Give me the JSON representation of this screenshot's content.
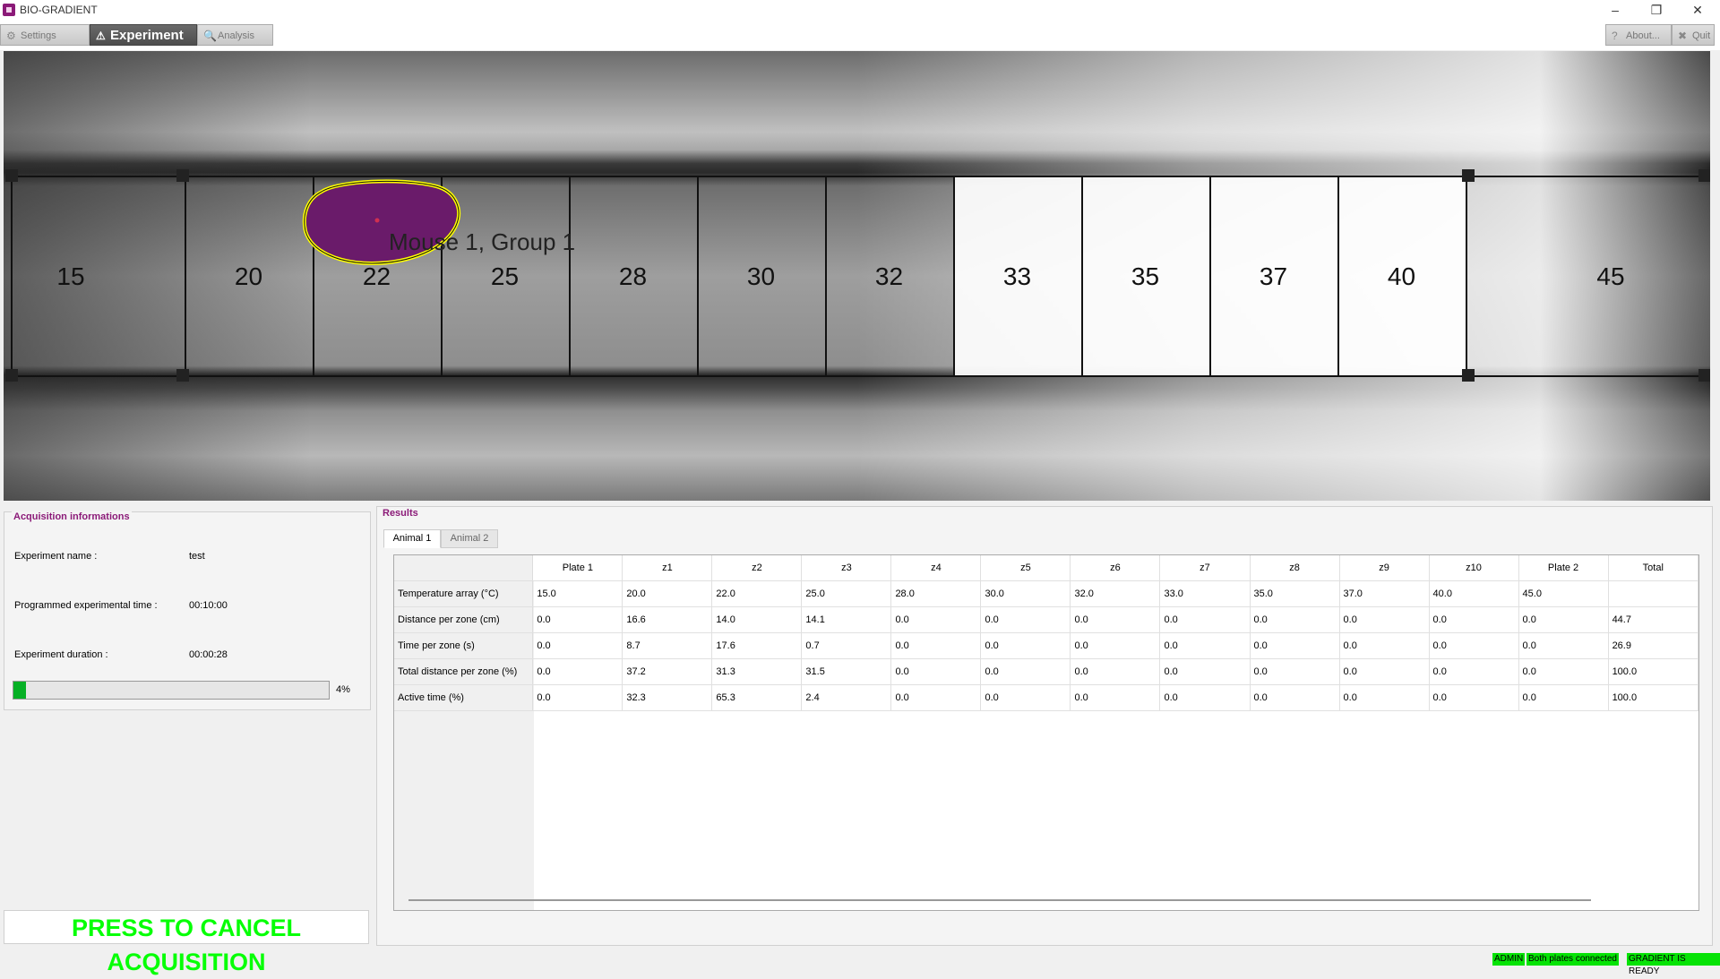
{
  "window": {
    "title": "BIO-GRADIENT",
    "minimize": "–",
    "restore": "❐",
    "close": "✕"
  },
  "toolbar": {
    "tabs": [
      {
        "label": "Settings",
        "icon": "⚙"
      },
      {
        "label": "Experiment",
        "icon": "⚠"
      },
      {
        "label": "Analysis",
        "icon": "🔍"
      }
    ],
    "about_label": "About...",
    "about_icon": "?",
    "quit_label": "Quit",
    "quit_icon": "✖"
  },
  "camera": {
    "zone_labels": [
      "15",
      "20",
      "22",
      "25",
      "28",
      "30",
      "32",
      "33",
      "35",
      "37",
      "40",
      "45"
    ],
    "mouse_label": "Mouse 1, Group 1"
  },
  "acquisition": {
    "title": "Acquisition informations",
    "experiment_name_label": "Experiment name :",
    "experiment_name": "test",
    "programmed_time_label": "Programmed experimental time :",
    "programmed_time": "00:10:00",
    "duration_label": "Experiment duration :",
    "duration": "00:00:28",
    "progress_percent": 4,
    "progress_text": "4%"
  },
  "cancel_button": "PRESS TO CANCEL ACQUISITION",
  "results": {
    "title": "Results",
    "tabs": [
      "Animal 1",
      "Animal 2"
    ],
    "columns": [
      "Plate 1",
      "z1",
      "z2",
      "z3",
      "z4",
      "z5",
      "z6",
      "z7",
      "z8",
      "z9",
      "z10",
      "Plate 2",
      "Total"
    ],
    "rows": [
      {
        "label": "Temperature array (°C)",
        "values": [
          "15.0",
          "20.0",
          "22.0",
          "25.0",
          "28.0",
          "30.0",
          "32.0",
          "33.0",
          "35.0",
          "37.0",
          "40.0",
          "45.0",
          ""
        ]
      },
      {
        "label": "Distance per zone (cm)",
        "values": [
          "0.0",
          "16.6",
          "14.0",
          "14.1",
          "0.0",
          "0.0",
          "0.0",
          "0.0",
          "0.0",
          "0.0",
          "0.0",
          "0.0",
          "44.7"
        ]
      },
      {
        "label": "Time per zone (s)",
        "values": [
          "0.0",
          "8.7",
          "17.6",
          "0.7",
          "0.0",
          "0.0",
          "0.0",
          "0.0",
          "0.0",
          "0.0",
          "0.0",
          "0.0",
          "26.9"
        ]
      },
      {
        "label": "Total distance per zone (%)",
        "values": [
          "0.0",
          "37.2",
          "31.3",
          "31.5",
          "0.0",
          "0.0",
          "0.0",
          "0.0",
          "0.0",
          "0.0",
          "0.0",
          "0.0",
          "100.0"
        ]
      },
      {
        "label": "Active time (%)",
        "values": [
          "0.0",
          "32.3",
          "65.3",
          "2.4",
          "0.0",
          "0.0",
          "0.0",
          "0.0",
          "0.0",
          "0.0",
          "0.0",
          "0.0",
          "100.0"
        ]
      }
    ]
  },
  "status": {
    "user": "ADMIN",
    "plates": "Both plates connected",
    "gradient": "GRADIENT IS READY"
  },
  "colors": {
    "accent": "#8b1a78",
    "cancel_text": "#06ff06",
    "status_green": "#06e306",
    "progress_green": "#06b025",
    "mouse_fill": "#6a1b6a",
    "mouse_outline": "#ffff00"
  }
}
